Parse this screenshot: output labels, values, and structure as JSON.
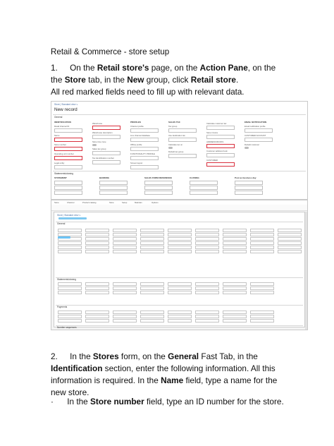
{
  "heading": "Retail & Commerce - store setup",
  "step1": {
    "num": "1.",
    "p1": "On the ",
    "b1": "Retail store's",
    "p2": " page, on the ",
    "b2": "Action Pane",
    "p3": ", on the ",
    "b3": "Store",
    "p4": " tab, in the ",
    "b4": "New",
    "p5": " group, click ",
    "b5": "Retail store",
    "p6": "."
  },
  "note": "All red marked fields need to fill up with relevant data.",
  "screenshot1": {
    "breadcrumb": "Store  |  Standard view  ∨",
    "title": "New record",
    "general_label": "General",
    "sections": [
      {
        "head": "IDENTIFICATION",
        "fields": [
          "Retail channel ID",
          "Name",
          "Store number",
          "Operating unit number",
          "Legal entity"
        ]
      },
      {
        "head": "",
        "fields": [
          "Warehouse",
          "Warehouse description",
          "Store time zone",
          "Sales tax group",
          "Tax identification number"
        ]
      },
      {
        "head": "PROFILES",
        "fields": [
          "Channel profile",
          "Live channel database",
          "Offline profile",
          "FUNCTIONALITY PROFILE",
          "Screen layout"
        ]
      },
      {
        "head": "SALES TAX",
        "fields": [
          "Tax group",
          "Use destination tax",
          "Calculate tax on",
          "Default tax group"
        ]
      },
      {
        "head": "",
        "fields": [
          "Calculate customer tax",
          "Store invoice",
          "ADDRESS BOOKS",
          "Customer address book",
          "CUSTOMER"
        ]
      },
      {
        "head": "EMAIL NOTIFICATION",
        "fields": [
          "Email notification profile",
          "CUSTOMER ACCOUNT",
          "Default customer"
        ]
      }
    ],
    "statements": "Statements/closing",
    "statement_cols": [
      "STATEMENT",
      "BANKING",
      "SALES FORM REFERENCE",
      "CLOSING",
      "Post as business day"
    ]
  },
  "screenshot2": {
    "tabs": [
      "Store",
      "Channel",
      "Product catalog",
      "Store",
      "Setup",
      "Maintain",
      "Options"
    ],
    "breadcrumb": "Store  |  Standard view  ∨",
    "general_label": "General",
    "statements": "Statements/closing",
    "payments": "Payments",
    "number_sequence": "Number sequences"
  },
  "step2": {
    "num": "2.",
    "p1": "In the ",
    "b1": "Stores",
    "p2": " form, on the ",
    "b2": "General",
    "p3": " Fast Tab, in the ",
    "b3": "Identification",
    "p4": " section, enter the following information. All this information is required. In the ",
    "b4": "Name",
    "p5": " field, type a name for the new store."
  },
  "bullet": {
    "mark": "·",
    "p1": "In the ",
    "b1": "Store number",
    "p2": " field, type an ID number for the store."
  }
}
